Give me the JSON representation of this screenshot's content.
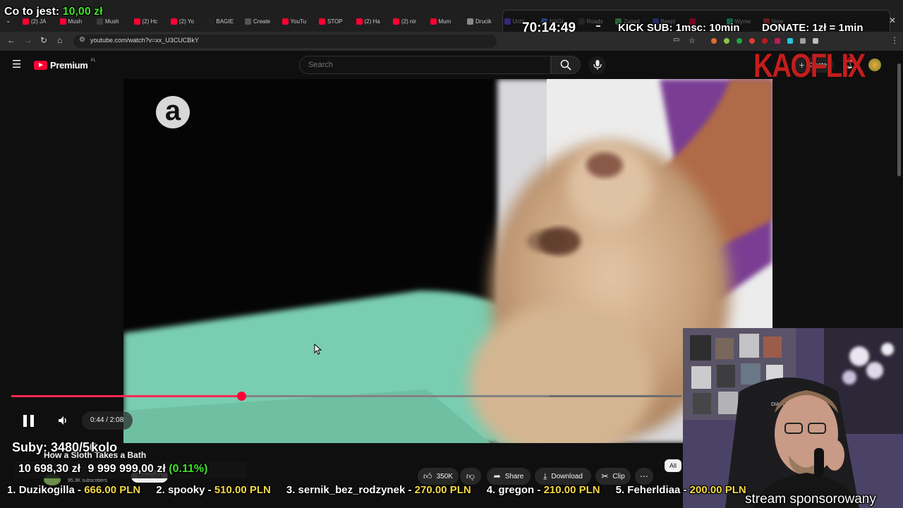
{
  "overlay_top": {
    "question_label": "Co to jest:",
    "question_value": "10,00 zł",
    "timer": "70:14:49",
    "kick_sub": "KICK SUB: 1msc: 10min",
    "donate": "DONATE: 1zł = 1min",
    "logo": "KAOFLIX"
  },
  "browser": {
    "tabs": [
      "(2) JA",
      "Mush",
      "Mush",
      "(2) Hc",
      "(2) Yo",
      "BAGIE",
      "Create",
      "YouTu",
      "STOP",
      "(2) Ha",
      "(2) nir",
      "Mum",
      "Drucik",
      "Untit",
      "NAGI",
      "Roads",
      "Zagad",
      "Beepl",
      "",
      "Wyme",
      "Now"
    ],
    "url": "youtube.com/watch?v=xx_U3CUCBkY"
  },
  "youtube": {
    "brand": "Premium",
    "brand_region": "PL",
    "search_placeholder": "Search",
    "create_label": "Create",
    "notif_count": "2"
  },
  "player": {
    "watermark": "a",
    "time": "0:44 / 2:08",
    "progress": 0.344
  },
  "below_video": {
    "title": "How a Sloth Takes a Bath",
    "subscribers": "95.3K subscribers",
    "subscribe_label": "Subscribe",
    "like_count": "350K",
    "share_label": "Share",
    "download_label": "Download",
    "clip_label": "Clip",
    "chip_all": "All"
  },
  "stream_stats": {
    "subs_line": "Suby: 3480/50",
    "subs_suffix": "kolo",
    "amount_raised": "10 698,30 zł",
    "goal": "9 999 999,00 zł",
    "percent": "(0.11%)"
  },
  "ticker": [
    {
      "rank": "1.",
      "name": "Duzikogilla",
      "amount": "666.00 PLN"
    },
    {
      "rank": "2.",
      "name": "spooky",
      "amount": "510.00 PLN"
    },
    {
      "rank": "3.",
      "name": "sernik_bez_rodzynek",
      "amount": "270.00 PLN"
    },
    {
      "rank": "4.",
      "name": "gregon",
      "amount": "210.00 PLN"
    },
    {
      "rank": "5.",
      "name": "Feherldiaa",
      "amount": "200.00 PLN"
    }
  ],
  "webcam": {
    "chair_brand": "DIABLO",
    "caption": "stream sponsorowany"
  },
  "colors": {
    "accent_red": "#ff0033",
    "money_green": "#41e02a",
    "gold": "#f5d942",
    "kaoflix_red": "#c41d1d"
  }
}
